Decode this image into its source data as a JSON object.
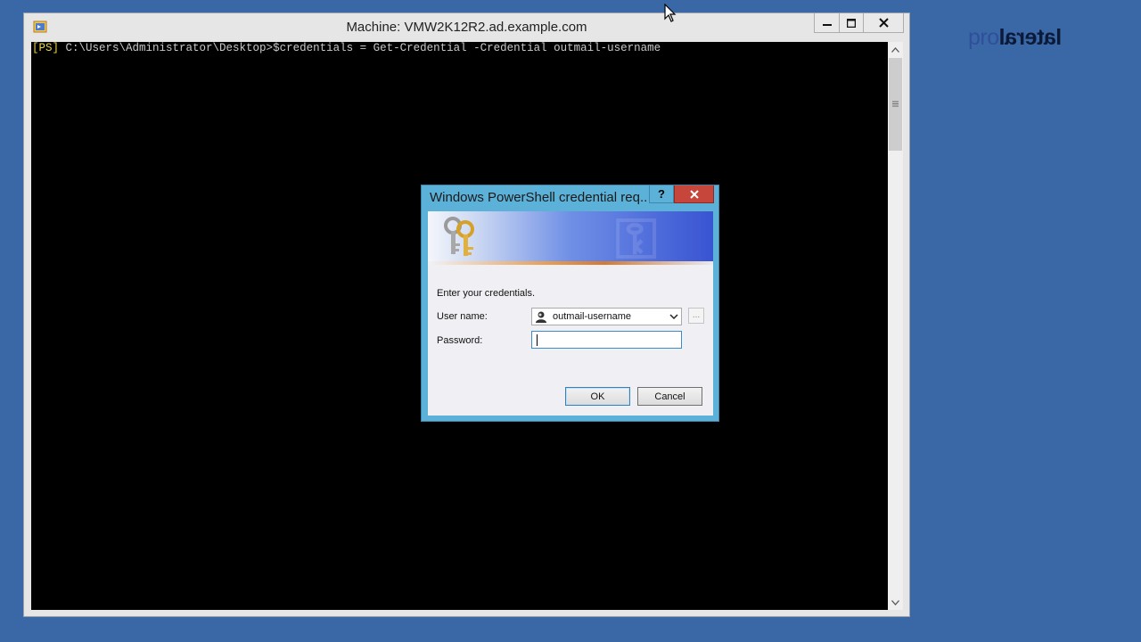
{
  "brand": {
    "logo_part1": "pro",
    "logo_part2": "lateral"
  },
  "vm_window": {
    "title": "Machine: VMW2K12R2.ad.example.com",
    "controls": {
      "minimize": "minimize",
      "maximize": "maximize",
      "close": "close"
    }
  },
  "console": {
    "prompt_tag": "[PS]",
    "prompt_path": " C:\\Users\\Administrator\\Desktop>",
    "command": "$credentials = Get-Credential -Credential outmail-username"
  },
  "dialog": {
    "title": "Windows PowerShell credential req...",
    "help_label": "?",
    "instruction": "Enter your credentials.",
    "username_label": "User name:",
    "username_value": "outmail-username",
    "browse_label": "...",
    "password_label": "Password:",
    "password_value": "",
    "ok_label": "OK",
    "cancel_label": "Cancel"
  },
  "colors": {
    "desktop": "#3a68a6",
    "console_bg": "#000000",
    "dialog_frame": "#5bb1d8",
    "close_red": "#c7463c"
  },
  "icons": [
    "vm-app-icon",
    "minimize-icon",
    "maximize-icon",
    "close-icon",
    "scroll-up-icon",
    "scroll-down-icon",
    "help-icon",
    "keys-icon",
    "user-icon",
    "dropdown-icon",
    "mouse-cursor-icon"
  ]
}
